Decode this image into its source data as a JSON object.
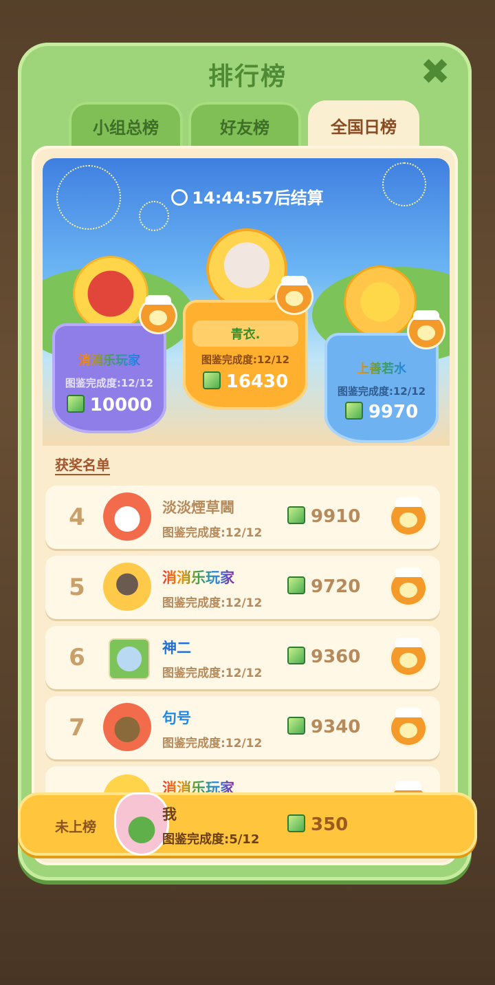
{
  "header": {
    "title": "排行榜"
  },
  "tabs": [
    {
      "label": "小组总榜",
      "active": false
    },
    {
      "label": "好友榜",
      "active": false
    },
    {
      "label": "全国日榜",
      "active": true
    }
  ],
  "countdown": {
    "time": "14:44:57",
    "suffix": "后结算"
  },
  "podium": [
    {
      "place": 2,
      "name": "消消乐玩家",
      "progress": "图鉴完成度:12/12",
      "score": "10000"
    },
    {
      "place": 1,
      "name": "青衣.",
      "progress": "图鉴完成度:12/12",
      "score": "16430"
    },
    {
      "place": 3,
      "name": "上善若水",
      "progress": "图鉴完成度:12/12",
      "score": "9970"
    }
  ],
  "section": {
    "title": "获奖名单"
  },
  "ranking": [
    {
      "rank": "4",
      "name": "淡淡煙草閪",
      "progress": "图鉴完成度:12/12",
      "score": "9910",
      "name_color": "#b58a5c"
    },
    {
      "rank": "5",
      "name": "消消乐玩家",
      "progress": "图鉴完成度:12/12",
      "score": "9720",
      "name_color": "rainbow"
    },
    {
      "rank": "6",
      "name": "神二",
      "progress": "图鉴完成度:12/12",
      "score": "9360",
      "name_color": "#1e6fd9"
    },
    {
      "rank": "7",
      "name": "句号",
      "progress": "图鉴完成度:12/12",
      "score": "9340",
      "name_color": "#1e88e5"
    },
    {
      "rank": "",
      "name": "消消乐玩家",
      "progress": "",
      "score": "",
      "name_color": "rainbow"
    }
  ],
  "me": {
    "status": "未上榜",
    "name": "我",
    "progress": "图鉴完成度:5/12",
    "score": "350"
  },
  "colors": {
    "panel": "#9fd57a",
    "accent_title": "#4f8a35",
    "my_bar": "#ffc53d"
  }
}
